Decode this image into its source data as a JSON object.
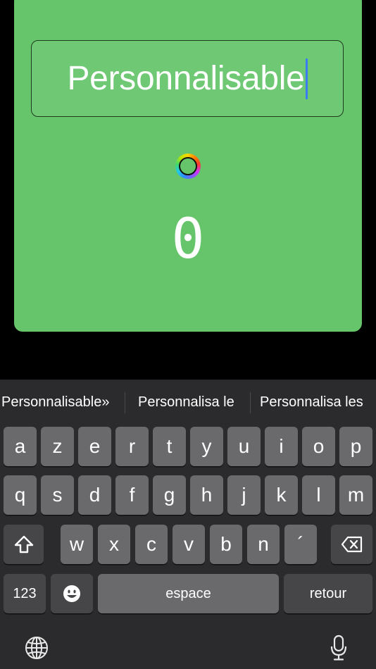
{
  "card": {
    "name_value": "Personnalisable",
    "counter_value": "0",
    "background_color": "#66c56b"
  },
  "keyboard": {
    "suggestions": [
      "Personnalisable»",
      "Personnalisa le",
      "Personnalisa les"
    ],
    "row1": [
      "a",
      "z",
      "e",
      "r",
      "t",
      "y",
      "u",
      "i",
      "o",
      "p"
    ],
    "row2": [
      "q",
      "s",
      "d",
      "f",
      "g",
      "h",
      "j",
      "k",
      "l",
      "m"
    ],
    "row3": [
      "w",
      "x",
      "c",
      "v",
      "b",
      "n",
      "´"
    ],
    "numbers_label": "123",
    "space_label": "espace",
    "return_label": "retour",
    "icons": [
      "shift-icon",
      "backspace-icon",
      "emoji-icon",
      "globe-icon",
      "microphone-icon"
    ]
  }
}
